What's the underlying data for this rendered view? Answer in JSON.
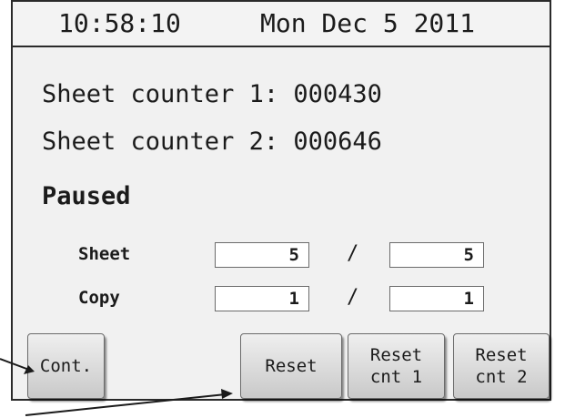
{
  "status_bar": {
    "time": "10:58:10",
    "date": "Mon Dec 5 2011"
  },
  "counters": {
    "line1": "Sheet counter 1: 000430",
    "line2": "Sheet counter 2: 000646"
  },
  "state": "Paused",
  "progress": {
    "sheet": {
      "label": "Sheet",
      "current": "5",
      "separator": "/",
      "total": "5"
    },
    "copy": {
      "label": "Copy",
      "current": "1",
      "separator": "/",
      "total": "1"
    }
  },
  "buttons": {
    "cont": "Cont.",
    "reset": "Reset",
    "reset_cnt1": "Reset\ncnt 1",
    "reset_cnt2": "Reset\ncnt 2"
  },
  "annotations": {
    "arrow_color": "#1b1b1b"
  }
}
